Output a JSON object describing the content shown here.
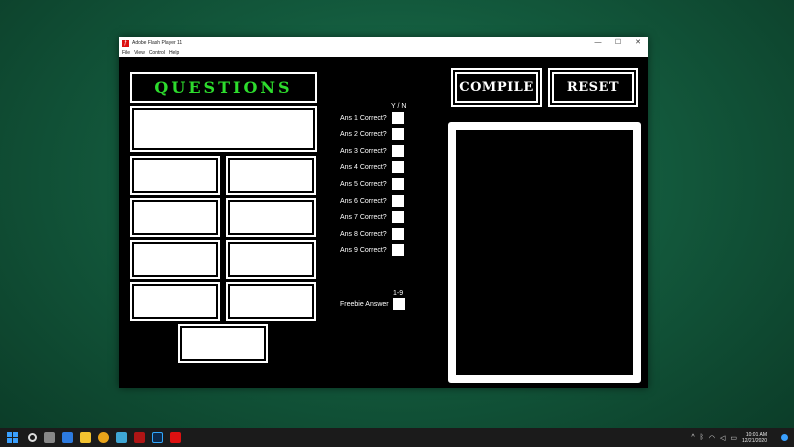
{
  "window": {
    "title": "Adobe Flash Player 11",
    "icon": "flash-player-icon",
    "controls": {
      "minimize": "—",
      "maximize": "☐",
      "close": "✕"
    }
  },
  "menu": [
    "File",
    "View",
    "Control",
    "Help"
  ],
  "questions_header": "QUESTIONS",
  "correct_column_label": "Y / N",
  "answer_checks": [
    "Ans 1 Correct?",
    "Ans 2 Correct?",
    "Ans 3 Correct?",
    "Ans 4 Correct?",
    "Ans 5 Correct?",
    "Ans 6 Correct?",
    "Ans 7 Correct?",
    "Ans 8 Correct?",
    "Ans 9 Correct?"
  ],
  "freebie": {
    "range_label": "1-9",
    "label": "Freebie Answer"
  },
  "buttons": {
    "compile": "COMPILE",
    "reset": "RESET"
  },
  "taskbar": {
    "icons": [
      "start-icon",
      "search-icon",
      "task-view-icon",
      "widgets-icon",
      "file-explorer-icon",
      "chrome-icon",
      "notepad-icon",
      "game-icon",
      "photoshop-icon",
      "flash-icon"
    ],
    "tray": {
      "chevron": "^",
      "time": "10:01 AM",
      "date": "12/21/2020"
    }
  },
  "colors": {
    "header_text": "#2ddc2d",
    "stage_bg": "#000000",
    "desktop": "#135a3d"
  }
}
